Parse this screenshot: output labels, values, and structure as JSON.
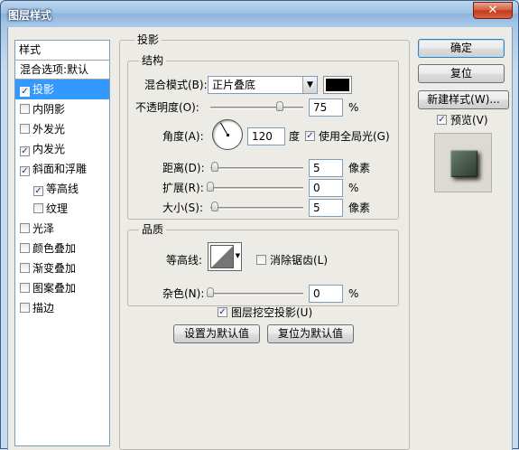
{
  "window": {
    "title": "图层样式",
    "close_icon": "✕"
  },
  "style_list": {
    "header": "样式",
    "blend_item": "混合选项:默认",
    "items": [
      {
        "label": "投影",
        "checked": true,
        "selected": true,
        "sub": false
      },
      {
        "label": "内阴影",
        "checked": false,
        "selected": false,
        "sub": false
      },
      {
        "label": "外发光",
        "checked": false,
        "selected": false,
        "sub": false
      },
      {
        "label": "内发光",
        "checked": true,
        "selected": false,
        "sub": false
      },
      {
        "label": "斜面和浮雕",
        "checked": true,
        "selected": false,
        "sub": false
      },
      {
        "label": "等高线",
        "checked": true,
        "selected": false,
        "sub": true
      },
      {
        "label": "纹理",
        "checked": false,
        "selected": false,
        "sub": true
      },
      {
        "label": "光泽",
        "checked": false,
        "selected": false,
        "sub": false
      },
      {
        "label": "颜色叠加",
        "checked": false,
        "selected": false,
        "sub": false
      },
      {
        "label": "渐变叠加",
        "checked": false,
        "selected": false,
        "sub": false
      },
      {
        "label": "图案叠加",
        "checked": false,
        "selected": false,
        "sub": false
      },
      {
        "label": "描边",
        "checked": false,
        "selected": false,
        "sub": false
      }
    ]
  },
  "panel": {
    "title": "投影",
    "structure": {
      "title": "结构",
      "blend_mode_label": "混合模式(B):",
      "blend_mode_value": "正片叠底",
      "blend_color": "#000000",
      "opacity_label": "不透明度(O):",
      "opacity_value": "75",
      "opacity_percent": 75,
      "angle_label": "角度(A):",
      "angle_value": "120",
      "angle_unit": "度",
      "global_light_label": "使用全局光(G)",
      "global_light_checked": true,
      "distance_label": "距离(D):",
      "distance_value": "5",
      "distance_unit": "像素",
      "spread_label": "扩展(R):",
      "spread_value": "0",
      "size_label": "大小(S):",
      "size_value": "5",
      "size_unit": "像素",
      "percent_sign": "%"
    },
    "quality": {
      "title": "品质",
      "contour_label": "等高线:",
      "antialias_label": "消除锯齿(L)",
      "antialias_checked": false,
      "noise_label": "杂色(N):",
      "noise_value": "0",
      "percent_sign": "%"
    },
    "knockout_label": "图层挖空投影(U)",
    "knockout_checked": true,
    "make_default": "设置为默认值",
    "reset_default": "复位为默认值"
  },
  "buttons": {
    "ok": "确定",
    "reset": "复位",
    "new_style": "新建样式(W)...",
    "preview_label": "预览(V)",
    "preview_checked": true
  }
}
